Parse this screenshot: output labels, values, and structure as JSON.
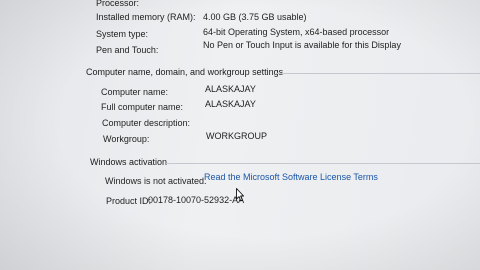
{
  "system": {
    "processor_label": "Processor:",
    "processor_value": "",
    "memory_label": "Installed memory (RAM):",
    "memory_value": "4.00 GB (3.75 GB usable)",
    "type_label": "System type:",
    "type_value": "64-bit Operating System, x64-based processor",
    "pen_label": "Pen and Touch:",
    "pen_value": "No Pen or Touch Input is available for this Display"
  },
  "computer": {
    "title": "Computer name, domain, and workgroup settings",
    "name_label": "Computer name:",
    "name_value": "ALASKAJAY",
    "full_label": "Full computer name:",
    "full_value": "ALASKAJAY",
    "desc_label": "Computer description:",
    "desc_value": "",
    "workgroup_label": "Workgroup:",
    "workgroup_value": "WORKGROUP"
  },
  "activation": {
    "title": "Windows activation",
    "status": "Windows is not activated.",
    "link": "Read the Microsoft Software License Terms",
    "product_id_label": "Product ID:",
    "product_id_value": "00178-10070-52932-AA"
  },
  "colors": {
    "link": "#1a56a8",
    "separator": "#c4c9d0"
  }
}
